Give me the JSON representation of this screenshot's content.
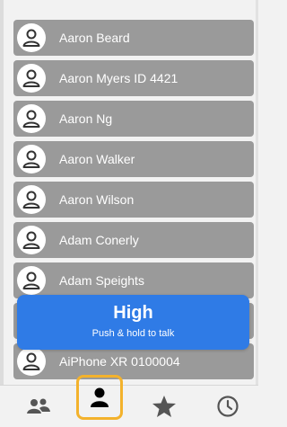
{
  "contacts": [
    {
      "name": "Aaron Beard"
    },
    {
      "name": "Aaron Myers ID 4421"
    },
    {
      "name": "Aaron Ng"
    },
    {
      "name": "Aaron Walker"
    },
    {
      "name": "Aaron Wilson"
    },
    {
      "name": "Adam Conerly"
    },
    {
      "name": "Adam Speights"
    },
    {
      "name": ""
    },
    {
      "name": "AiPhone  XR 0100004"
    }
  ],
  "ptt": {
    "title": "High",
    "subtitle": "Push & hold to talk",
    "color": "#2f7be6"
  },
  "tabs": [
    {
      "icon": "group-icon",
      "active": false
    },
    {
      "icon": "contact-icon",
      "active": true
    },
    {
      "icon": "star-icon",
      "active": false
    },
    {
      "icon": "clock-icon",
      "active": false
    }
  ],
  "colors": {
    "row": "#9a9a9a",
    "tab_highlight": "#f3b22c",
    "icon": "#555555"
  }
}
